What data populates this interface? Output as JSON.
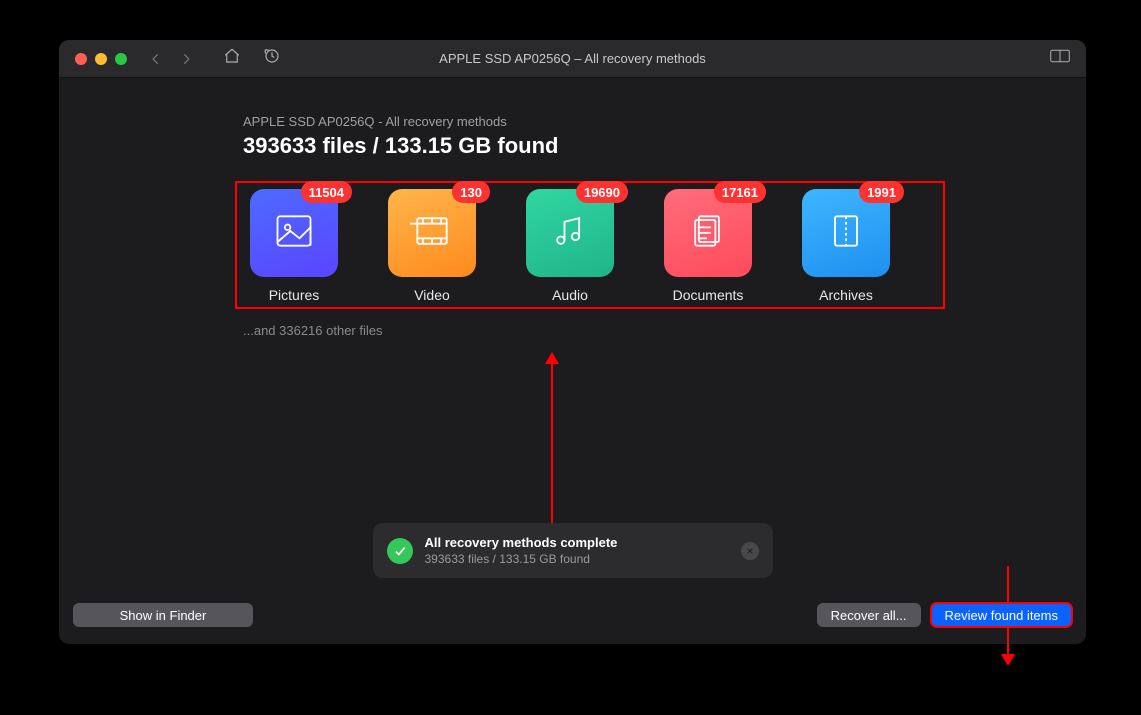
{
  "window": {
    "title": "APPLE SSD AP0256Q – All recovery methods"
  },
  "header": {
    "subtitle": "APPLE SSD AP0256Q - All recovery methods",
    "headline": "393633 files / 133.15 GB found"
  },
  "categories": [
    {
      "key": "pictures",
      "label": "Pictures",
      "count": "11504"
    },
    {
      "key": "video",
      "label": "Video",
      "count": "130"
    },
    {
      "key": "audio",
      "label": "Audio",
      "count": "19690"
    },
    {
      "key": "documents",
      "label": "Documents",
      "count": "17161"
    },
    {
      "key": "archives",
      "label": "Archives",
      "count": "1991"
    }
  ],
  "other_files_text": "...and 336216 other files",
  "toast": {
    "title": "All recovery methods complete",
    "subtitle": "393633 files / 133.15 GB found"
  },
  "footer": {
    "show_in_finder": "Show in Finder",
    "recover_all": "Recover all...",
    "review": "Review found items"
  }
}
